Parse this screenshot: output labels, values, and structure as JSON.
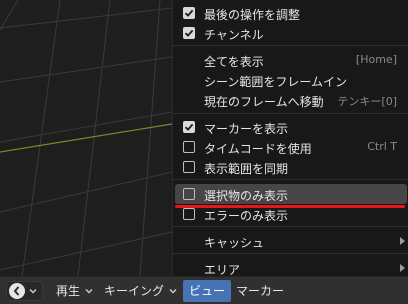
{
  "header": {
    "editor_icon": "clock-icon",
    "menus": [
      {
        "label": "再生"
      },
      {
        "label": "キーイング"
      },
      {
        "label": "ビュー"
      },
      {
        "label": "マーカー"
      }
    ]
  },
  "menu": {
    "items": [
      {
        "label": "最後の操作を調整",
        "checkbox": "checked"
      },
      {
        "label": "チャンネル",
        "checkbox": "checked"
      },
      {
        "label": "全てを表示",
        "shortcut": "[Home]"
      },
      {
        "label": "シーン範囲をフレームイン"
      },
      {
        "label": "現在のフレームへ移動",
        "shortcut": "テンキー[0]"
      },
      {
        "label": "マーカーを表示",
        "checkbox": "checked"
      },
      {
        "label": "タイムコードを使用",
        "checkbox": "unchecked",
        "shortcut": "Ctrl T"
      },
      {
        "label": "表示範囲を同期",
        "checkbox": "unchecked"
      },
      {
        "label": "選択物のみ表示",
        "checkbox": "unchecked"
      },
      {
        "label": "エラーのみ表示",
        "checkbox": "unchecked"
      },
      {
        "label": "キャッシュ",
        "submenu": true
      },
      {
        "label": "エリア",
        "submenu": true
      }
    ]
  },
  "colors": {
    "accent": "#4772b3",
    "annotation": "#e8141e",
    "grid_line": "#6f8f2a"
  }
}
